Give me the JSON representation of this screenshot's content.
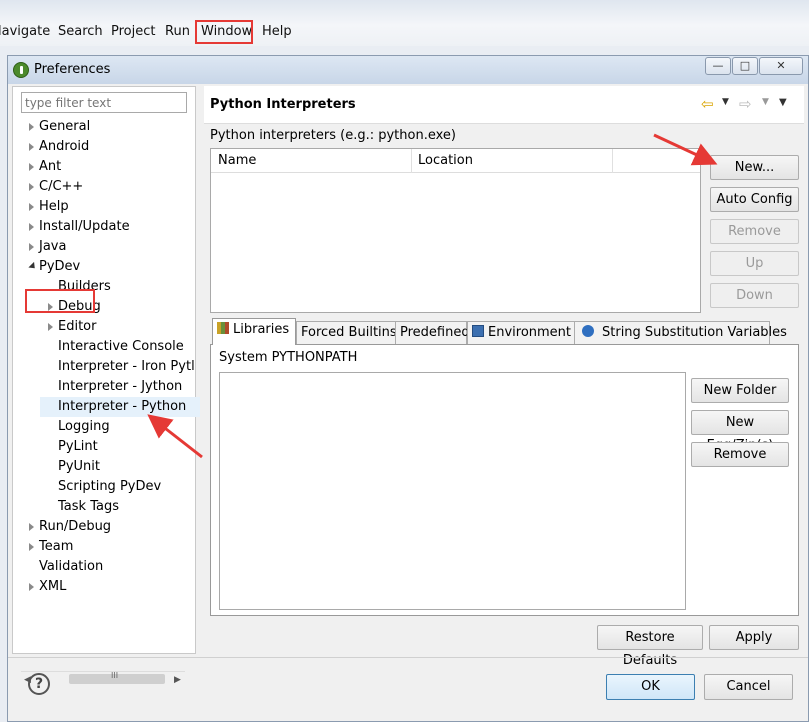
{
  "menubar": {
    "items": [
      "lavigate",
      "Search",
      "Project",
      "Run",
      "Window",
      "Help"
    ]
  },
  "dialog": {
    "title": "Preferences",
    "filter_placeholder": "type filter text"
  },
  "tree": {
    "items": [
      {
        "label": "General",
        "state": "collapsed",
        "level": 0
      },
      {
        "label": "Android",
        "state": "collapsed",
        "level": 0
      },
      {
        "label": "Ant",
        "state": "collapsed",
        "level": 0
      },
      {
        "label": "C/C++",
        "state": "collapsed",
        "level": 0
      },
      {
        "label": "Help",
        "state": "collapsed",
        "level": 0
      },
      {
        "label": "Install/Update",
        "state": "collapsed",
        "level": 0
      },
      {
        "label": "Java",
        "state": "collapsed",
        "level": 0
      },
      {
        "label": "PyDev",
        "state": "expanded",
        "level": 0
      },
      {
        "label": "Builders",
        "state": "leaf",
        "level": 1
      },
      {
        "label": "Debug",
        "state": "collapsed",
        "level": 1
      },
      {
        "label": "Editor",
        "state": "collapsed",
        "level": 1
      },
      {
        "label": "Interactive Console",
        "state": "leaf",
        "level": 1
      },
      {
        "label": "Interpreter - Iron Pytl",
        "state": "leaf",
        "level": 1
      },
      {
        "label": "Interpreter - Jython",
        "state": "leaf",
        "level": 1
      },
      {
        "label": "Interpreter - Python",
        "state": "leaf",
        "level": 1,
        "selected": true
      },
      {
        "label": "Logging",
        "state": "leaf",
        "level": 1
      },
      {
        "label": "PyLint",
        "state": "leaf",
        "level": 1
      },
      {
        "label": "PyUnit",
        "state": "leaf",
        "level": 1
      },
      {
        "label": "Scripting PyDev",
        "state": "leaf",
        "level": 1
      },
      {
        "label": "Task Tags",
        "state": "leaf",
        "level": 1
      },
      {
        "label": "Run/Debug",
        "state": "collapsed",
        "level": 0
      },
      {
        "label": "Team",
        "state": "collapsed",
        "level": 0
      },
      {
        "label": "Validation",
        "state": "leaf",
        "level": 0
      },
      {
        "label": "XML",
        "state": "collapsed",
        "level": 0
      }
    ],
    "scroll_grip": "III"
  },
  "page": {
    "title": "Python Interpreters",
    "interpreters_label": "Python interpreters (e.g.: python.exe)",
    "columns": [
      "Name",
      "Location"
    ],
    "buttons": {
      "new": "New...",
      "auto_config": "Auto Config",
      "remove": "Remove",
      "up": "Up",
      "down": "Down"
    },
    "tabs": [
      "Libraries",
      "Forced Builtins",
      "Predefined",
      "Environment",
      "String Substitution Variables"
    ],
    "active_tab": "Libraries",
    "syspath_label": "System PYTHONPATH",
    "lib_buttons": {
      "new_folder": "New Folder",
      "new_egg": "New Egg/Zip(s)",
      "remove": "Remove"
    },
    "restore_defaults": "Restore Defaults",
    "apply": "Apply"
  },
  "footer": {
    "ok": "OK",
    "cancel": "Cancel",
    "help_glyph": "?"
  },
  "colors": {
    "highlight": "#e53935",
    "selection": "#e5f1fb"
  }
}
